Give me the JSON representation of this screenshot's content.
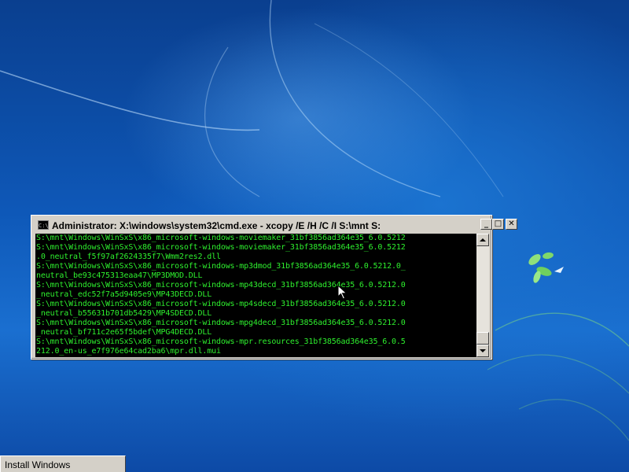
{
  "desktop": {
    "background_color": "#0e58b8"
  },
  "window": {
    "title": "Administrator: X:\\windows\\system32\\cmd.exe - xcopy  /E /H /C /I S:\\mnt S:",
    "icon": "cmd-icon",
    "icon_text": "C:\\",
    "minimize_glyph": "_",
    "maximize_glyph": "□",
    "close_glyph": "✕"
  },
  "console": {
    "text_color": "#2ef02e",
    "background": "#000000",
    "lines": [
      "S:\\mnt\\Windows\\WinSxS\\x86_microsoft-windows-moviemaker_31bf3856ad364e35_6.0.5212",
      "S:\\mnt\\Windows\\WinSxS\\x86_microsoft-windows-moviemaker_31bf3856ad364e35_6.0.5212",
      ".0_neutral_f5f97af2624335f7\\Wmm2res2.dll",
      "S:\\mnt\\Windows\\WinSxS\\x86_microsoft-windows-mp3dmod_31bf3856ad364e35_6.0.5212.0_",
      "neutral_be93c475313eaa47\\MP3DMOD.DLL",
      "S:\\mnt\\Windows\\WinSxS\\x86_microsoft-windows-mp43decd_31bf3856ad364e35_6.0.5212.0",
      "_neutral_edc52f7a5d9405e9\\MP43DECD.DLL",
      "S:\\mnt\\Windows\\WinSxS\\x86_microsoft-windows-mp4sdecd_31bf3856ad364e35_6.0.5212.0",
      "_neutral_b55631b701db5429\\MP4SDECD.DLL",
      "S:\\mnt\\Windows\\WinSxS\\x86_microsoft-windows-mpg4decd_31bf3856ad364e35_6.0.5212.0",
      "_neutral_bf711c2e65f5bdef\\MPG4DECD.DLL",
      "S:\\mnt\\Windows\\WinSxS\\x86_microsoft-windows-mpr.resources_31bf3856ad364e35_6.0.5",
      "212.0_en-us_e7f976e64cad2ba6\\mpr.dll.mui"
    ]
  },
  "taskbar": {
    "button_label": "Install Windows"
  }
}
